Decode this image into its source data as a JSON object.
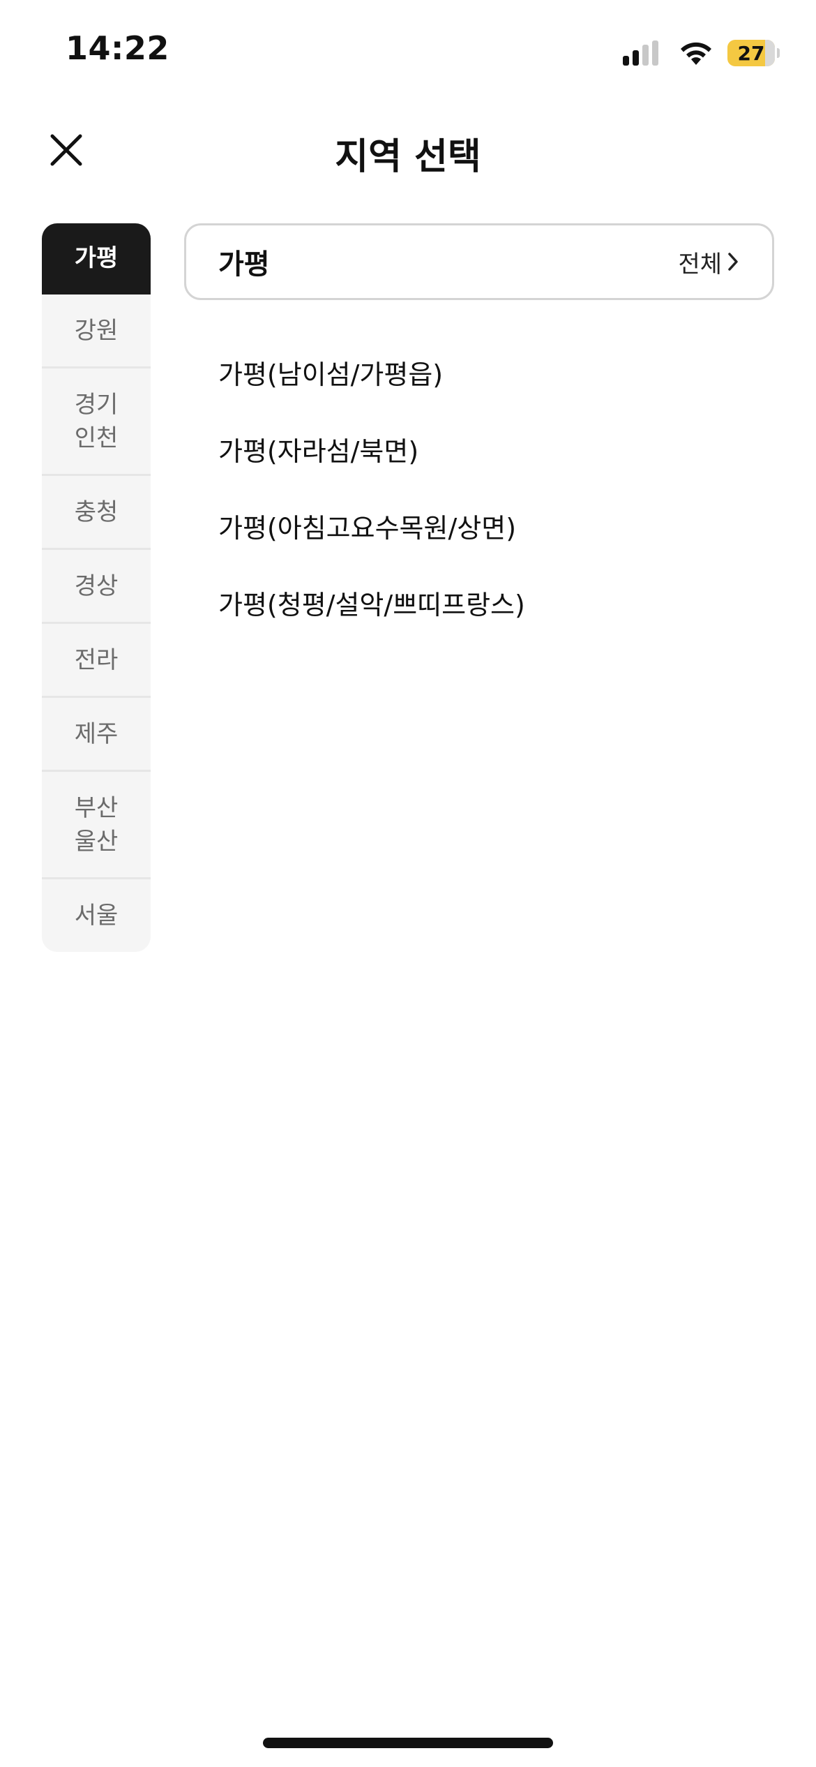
{
  "status_bar": {
    "time": "14:22",
    "battery_level": "27",
    "signal_bars_active": 2,
    "signal_bars_total": 4,
    "icons": [
      "signal-icon",
      "wifi-icon",
      "battery-icon"
    ]
  },
  "header": {
    "title": "지역 선택",
    "close_icon": "close-icon"
  },
  "sidebar": {
    "items": [
      {
        "label": "가평",
        "active": true
      },
      {
        "label": "강원",
        "active": false
      },
      {
        "label": "경기\n인천",
        "active": false
      },
      {
        "label": "충청",
        "active": false
      },
      {
        "label": "경상",
        "active": false
      },
      {
        "label": "전라",
        "active": false
      },
      {
        "label": "제주",
        "active": false
      },
      {
        "label": "부산\n울산",
        "active": false
      },
      {
        "label": "서울",
        "active": false
      }
    ]
  },
  "main": {
    "selected_region": "가평",
    "all_label": "전체",
    "chevron_icon": "chevron-right-icon",
    "sub_regions": [
      "가평(남이섬/가평읍)",
      "가평(자라섬/북면)",
      "가평(아침고요수목원/상면)",
      "가평(청평/설악/쁘띠프랑스)"
    ]
  },
  "colors": {
    "active_tab_bg": "#1a1a1a",
    "sidebar_bg": "#f5f5f5",
    "battery_fill": "#f4c842",
    "card_border": "#d4d4d4"
  }
}
